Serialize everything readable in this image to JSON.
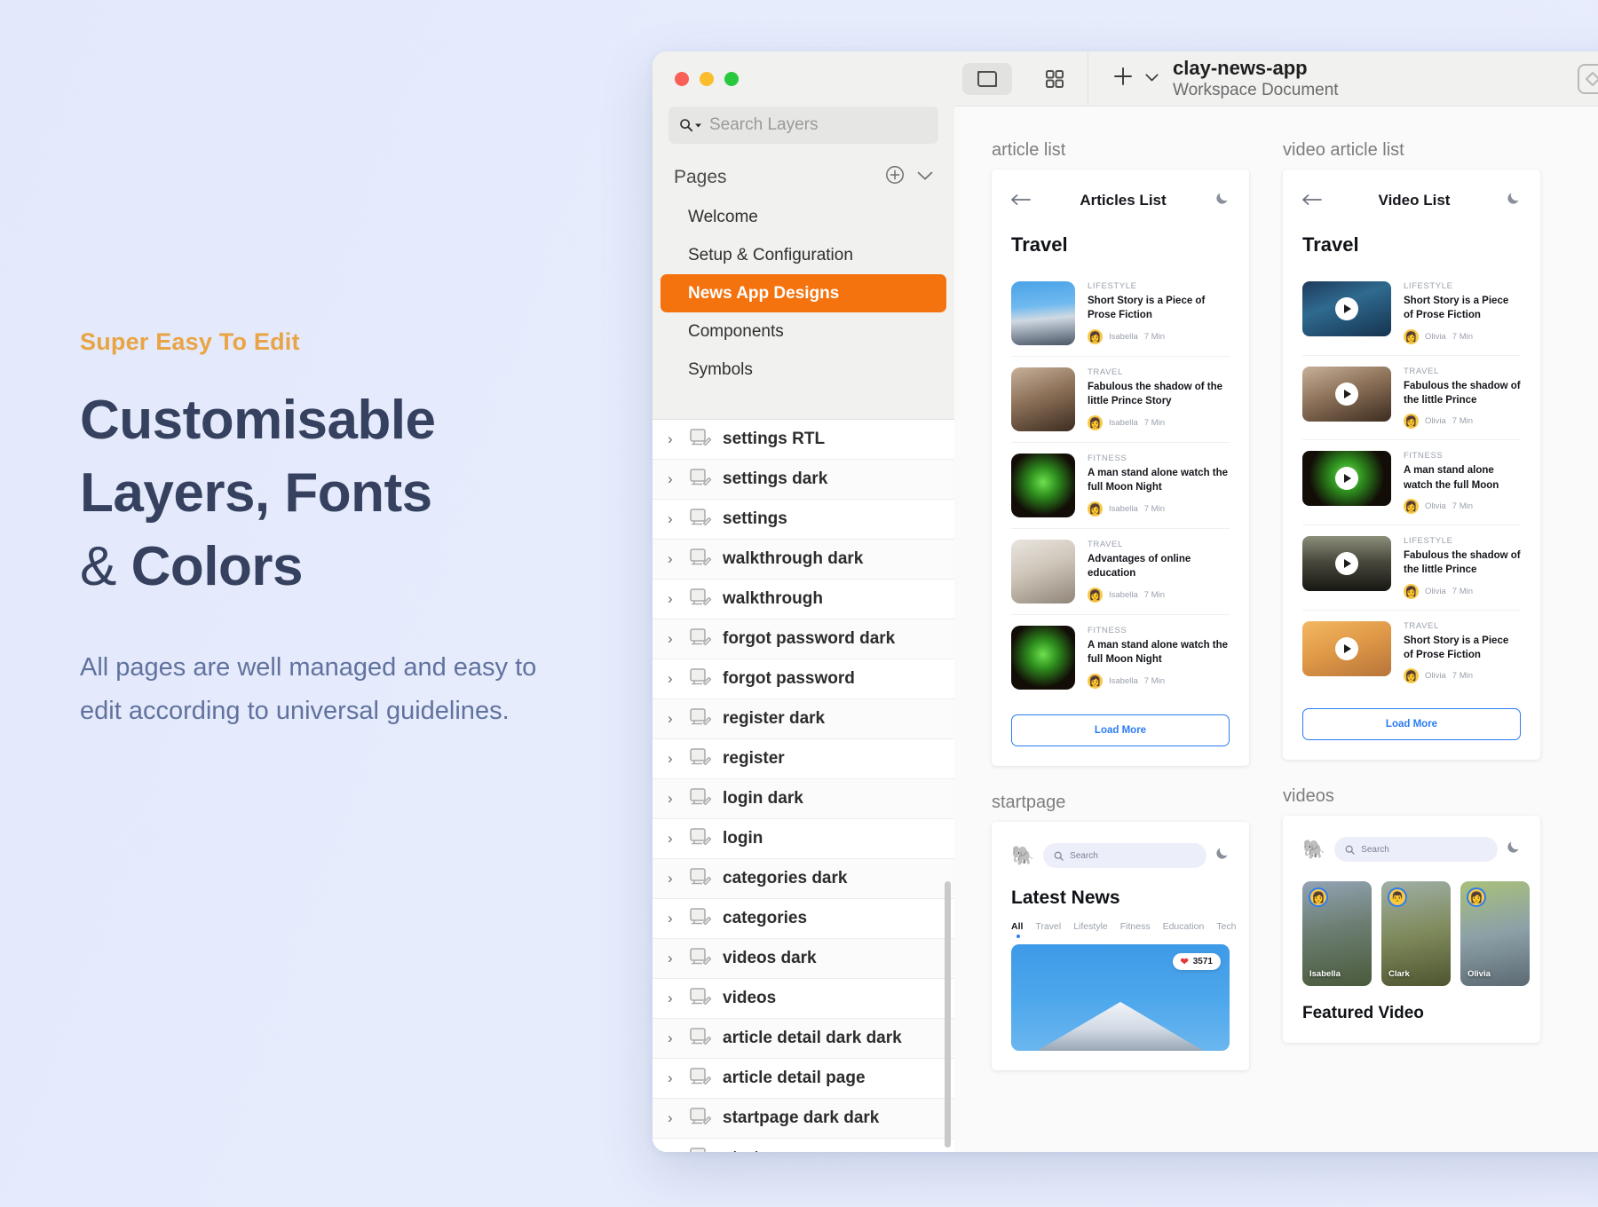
{
  "promo": {
    "eyebrow": "Super Easy To Edit",
    "headline_line1": "Customisable",
    "headline_line2": "Layers, Fonts",
    "headline_amp": "&",
    "headline_line3": "Colors",
    "body": "All pages are well managed and easy to edit according to universal guidelines."
  },
  "window": {
    "search": {
      "placeholder": "Search Layers"
    },
    "pages_section": {
      "title": "Pages"
    },
    "pages": [
      {
        "label": "Welcome",
        "active": false
      },
      {
        "label": "Setup & Configuration",
        "active": false
      },
      {
        "label": "News App Designs",
        "active": true
      },
      {
        "label": "Components",
        "active": false
      },
      {
        "label": "Symbols",
        "active": false
      }
    ],
    "layers": [
      "settings RTL",
      "settings dark",
      "settings",
      "walkthrough dark",
      "walkthrough",
      "forgot password dark",
      "forgot password",
      "register dark",
      "register",
      "login dark",
      "login",
      "categories dark",
      "categories",
      "videos dark",
      "videos",
      "article detail dark dark",
      "article detail page",
      "startpage dark dark",
      "startpage"
    ]
  },
  "toolbar": {
    "document_title": "clay-news-app",
    "document_subtitle": "Workspace Document"
  },
  "canvas": {
    "artboards": {
      "article_list": {
        "label": "article list",
        "header_title": "Articles List",
        "section_title": "Travel",
        "load_more": "Load More",
        "items": [
          {
            "category": "LIFESTYLE",
            "headline": "Short Story is a Piece of Prose Fiction",
            "author": "Isabella",
            "read_time": "7 Min",
            "img": "img-mountain",
            "avatar": "👩"
          },
          {
            "category": "TRAVEL",
            "headline": "Fabulous the shadow of the little Prince Story",
            "author": "Isabella",
            "read_time": "7 Min",
            "img": "img-tent",
            "avatar": "👩"
          },
          {
            "category": "FITNESS",
            "headline": "A man stand alone watch the full Moon Night",
            "author": "Isabella",
            "read_time": "7 Min",
            "img": "img-plant",
            "avatar": "👩"
          },
          {
            "category": "TRAVEL",
            "headline": "Advantages of online education",
            "author": "Isabella",
            "read_time": "7 Min",
            "img": "img-sofa",
            "avatar": "👩"
          },
          {
            "category": "FITNESS",
            "headline": "A man stand alone watch the full Moon Night",
            "author": "Isabella",
            "read_time": "7 Min",
            "img": "img-plant",
            "avatar": "👩"
          }
        ]
      },
      "video_article_list": {
        "label": "video article list",
        "header_title": "Video List",
        "section_title": "Travel",
        "load_more": "Load More",
        "items": [
          {
            "category": "LIFESTYLE",
            "headline": "Short Story is a Piece of Prose Fiction",
            "author": "Olivia",
            "read_time": "7 Min",
            "img": "img-forest",
            "avatar": "👩"
          },
          {
            "category": "TRAVEL",
            "headline": "Fabulous the shadow of the little Prince",
            "author": "Olivia",
            "read_time": "7 Min",
            "img": "img-tent",
            "avatar": "👩"
          },
          {
            "category": "FITNESS",
            "headline": "A man stand alone watch the full Moon",
            "author": "Olivia",
            "read_time": "7 Min",
            "img": "img-plant",
            "avatar": "👩"
          },
          {
            "category": "LIFESTYLE",
            "headline": "Fabulous the shadow of the little Prince",
            "author": "Olivia",
            "read_time": "7 Min",
            "img": "img-city",
            "avatar": "👩"
          },
          {
            "category": "TRAVEL",
            "headline": "Short Story is a Piece of Prose Fiction",
            "author": "Olivia",
            "read_time": "7 Min",
            "img": "img-wheat",
            "avatar": "👩"
          }
        ]
      },
      "startpage": {
        "label": "startpage",
        "search_placeholder": "Search",
        "heading": "Latest News",
        "tabs": [
          "All",
          "Travel",
          "Lifestyle",
          "Fitness",
          "Education",
          "Tech"
        ],
        "active_tab": "All",
        "hero_likes": "3571"
      },
      "videos": {
        "label": "videos",
        "search_placeholder": "Search",
        "cards": [
          {
            "name": "Isabella",
            "img": "img-lake",
            "avatar": "👩"
          },
          {
            "name": "Clark",
            "img": "img-fence",
            "avatar": "👨"
          },
          {
            "name": "Olivia",
            "img": "img-road",
            "avatar": "👩"
          }
        ],
        "featured_title": "Featured Video"
      }
    }
  },
  "colors": {
    "accent_orange": "#f4730f",
    "accent_blue": "#2b7cf2",
    "promo_eyebrow": "#e8a445",
    "promo_heading": "#35415e",
    "promo_body": "#61729e"
  }
}
